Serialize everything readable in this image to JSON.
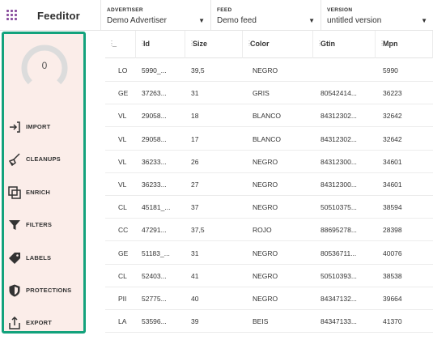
{
  "app": {
    "title": "Feeditor",
    "logo_icon": "grid-dots-icon",
    "accent": "#13a27c",
    "brand_color": "#8a4d9e"
  },
  "header": {
    "advertiser": {
      "caption": "ADVERTISER",
      "value": "Demo Advertiser"
    },
    "feed": {
      "caption": "FEED",
      "value": "Demo feed"
    },
    "version": {
      "caption": "VERSION",
      "value": "untitled version"
    }
  },
  "sidebar": {
    "score": "0",
    "items": [
      {
        "label": "IMPORT",
        "icon": "import-arrow-icon"
      },
      {
        "label": "CLEANUPS",
        "icon": "broom-icon"
      },
      {
        "label": "ENRICH",
        "icon": "layers-icon"
      },
      {
        "label": "FILTERS",
        "icon": "funnel-icon"
      },
      {
        "label": "LABELS",
        "icon": "tag-icon"
      },
      {
        "label": "PROTECTIONS",
        "icon": "shield-icon"
      },
      {
        "label": "EXPORT",
        "icon": "export-icon"
      }
    ]
  },
  "table": {
    "columns": [
      "_",
      "Id",
      "Size",
      "Color",
      "Gtin",
      "Mpn"
    ],
    "rows": [
      [
        "LO",
        "5990_...",
        "39,5",
        "NEGRO",
        "",
        "5990"
      ],
      [
        "GE",
        "37263...",
        "31",
        "GRIS",
        "80542414...",
        "36223"
      ],
      [
        "VL",
        "29058...",
        "18",
        "BLANCO",
        "84312302...",
        "32642"
      ],
      [
        "VL",
        "29058...",
        "17",
        "BLANCO",
        "84312302...",
        "32642"
      ],
      [
        "VL",
        "36233...",
        "26",
        "NEGRO",
        "84312300...",
        "34601"
      ],
      [
        "VL",
        "36233...",
        "27",
        "NEGRO",
        "84312300...",
        "34601"
      ],
      [
        "CL",
        "45181_...",
        "37",
        "NEGRO",
        "50510375...",
        "38594"
      ],
      [
        "CC",
        "47291...",
        "37,5",
        "ROJO",
        "88695278...",
        "28398"
      ],
      [
        "GE",
        "51183_...",
        "31",
        "NEGRO",
        "80536711...",
        "40076"
      ],
      [
        "CL",
        "52403...",
        "41",
        "NEGRO",
        "50510393...",
        "38538"
      ],
      [
        "PII",
        "52775...",
        "40",
        "NEGRO",
        "84347132...",
        "39664"
      ],
      [
        "LA",
        "53596...",
        "39",
        "BEIS",
        "84347133...",
        "41370"
      ]
    ]
  }
}
